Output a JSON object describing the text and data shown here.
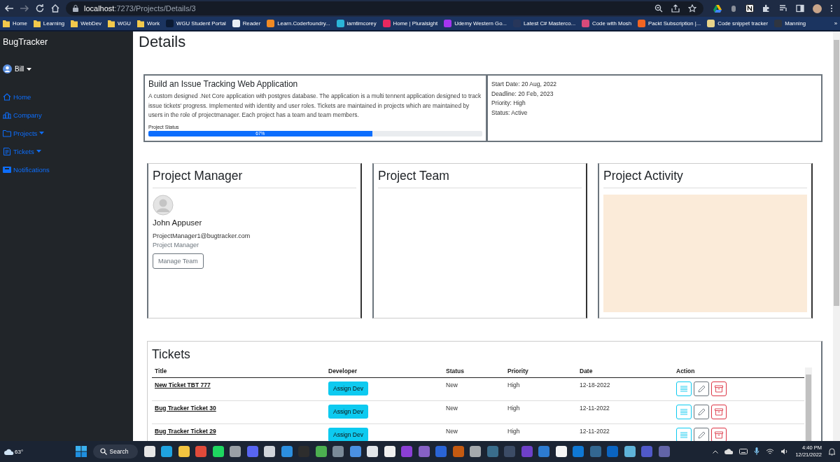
{
  "browser": {
    "url_host": "localhost",
    "url_path": ":7273/Projects/Details/3",
    "bookmarks": [
      {
        "label": "Home",
        "kind": "folder",
        "color": "#f2c94c"
      },
      {
        "label": "Learning",
        "kind": "folder",
        "color": "#f2c94c"
      },
      {
        "label": "WebDev",
        "kind": "folder",
        "color": "#f2c94c"
      },
      {
        "label": "WGU",
        "kind": "folder",
        "color": "#f2c94c"
      },
      {
        "label": "Work",
        "kind": "folder",
        "color": "#f2c94c"
      },
      {
        "label": "WGU Student Portal",
        "kind": "site",
        "color": "#0b1a33"
      },
      {
        "label": "Reader",
        "kind": "site",
        "color": "#e8eef5"
      },
      {
        "label": "Learn.Coderfoundry...",
        "kind": "site",
        "color": "#f08a24"
      },
      {
        "label": "iamtimcorey",
        "kind": "site",
        "color": "#2bb5d8"
      },
      {
        "label": "Home | Pluralsight",
        "kind": "site",
        "color": "#e8285f"
      },
      {
        "label": "Udemy Western Go...",
        "kind": "site",
        "color": "#a435f0"
      },
      {
        "label": "Latest C# Masterco...",
        "kind": "site",
        "color": "#27365a"
      },
      {
        "label": "Code with Mosh",
        "kind": "site",
        "color": "#d84a7a"
      },
      {
        "label": "Packt Subscription |...",
        "kind": "site",
        "color": "#f26522"
      },
      {
        "label": "Code snippet tracker",
        "kind": "site",
        "color": "#e8d48a"
      },
      {
        "label": "Manning",
        "kind": "site",
        "color": "#2f3540"
      }
    ],
    "more": "»"
  },
  "sidebar": {
    "brand": "BugTracker",
    "user": "Bill",
    "items": [
      {
        "label": "Home",
        "expandable": false
      },
      {
        "label": "Company",
        "expandable": false
      },
      {
        "label": "Projects",
        "expandable": true
      },
      {
        "label": "Tickets",
        "expandable": true
      },
      {
        "label": "Notifications",
        "expandable": false
      }
    ]
  },
  "page": {
    "heading": "Details"
  },
  "project": {
    "title": "Build an Issue Tracking Web Application",
    "description": "A custom designed .Net Core application with postgres database. The application is a multi tennent application designed to track issue tickets' progress. Implemented with identity and user roles. Tickets are maintained in projects which are maintained by users in the role of projectmanager. Each project has a team and team members.",
    "progress_label": "Project Status",
    "progress": {
      "level": 0.67,
      "text": "67%"
    },
    "info": [
      "Start Date: 20 Aug, 2022",
      "Deadline: 20 Feb, 2023",
      "Priority: High",
      "Status: Active"
    ]
  },
  "manager_card": {
    "title": "Project Manager",
    "name": "John Appuser",
    "email": "ProjectManager1@bugtracker.com",
    "role": "Project Manager",
    "button": "Manage Team"
  },
  "team_card": {
    "title": "Project Team"
  },
  "activity_card": {
    "title": "Project Activity"
  },
  "tickets": {
    "title": "Tickets",
    "columns": [
      "Title",
      "Developer",
      "Status",
      "Priority",
      "Date",
      "Action"
    ],
    "rows": [
      {
        "title": "New Ticket TBT 777",
        "developer_button": "Assign Dev",
        "status": "New",
        "priority": "High",
        "date": "12-18-2022"
      },
      {
        "title": "Bug Tracker Ticket 30",
        "developer_button": "Assign Dev",
        "status": "New",
        "priority": "High",
        "date": "12-11-2022"
      },
      {
        "title": "Bug Tracker Ticket 29",
        "developer_button": "Assign Dev",
        "status": "New",
        "priority": "High",
        "date": "12-11-2022"
      }
    ]
  },
  "taskbar": {
    "weather": "63°",
    "search": "Search",
    "apps": [
      {
        "color": "#e6e6e6"
      },
      {
        "color": "#1fa3e0"
      },
      {
        "color": "#f3c440"
      },
      {
        "color": "#e04a3a"
      },
      {
        "color": "#1ed760"
      },
      {
        "color": "#9aa0a6"
      },
      {
        "color": "#5865f2"
      },
      {
        "color": "#d0d4da"
      },
      {
        "color": "#2c8fe0"
      },
      {
        "color": "#2d2d2d"
      },
      {
        "color": "#4caf50"
      },
      {
        "color": "#7a8a99"
      },
      {
        "color": "#4a90e2"
      },
      {
        "color": "#e2e6ea"
      },
      {
        "color": "#f0f0f0"
      },
      {
        "color": "#8b3fd6"
      },
      {
        "color": "#8661c5"
      },
      {
        "color": "#2a64d6"
      },
      {
        "color": "#c55a11"
      },
      {
        "color": "#a5a9ad"
      },
      {
        "color": "#3a6d8c"
      },
      {
        "color": "#3c4c66"
      },
      {
        "color": "#6e40c9"
      },
      {
        "color": "#2d7bd1"
      },
      {
        "color": "#f5f5f5"
      },
      {
        "color": "#0f78d4"
      },
      {
        "color": "#336791"
      },
      {
        "color": "#0a64c2"
      },
      {
        "color": "#5fb3d9"
      },
      {
        "color": "#5059c9"
      },
      {
        "color": "#6264a7"
      }
    ],
    "time": "4:40 PM",
    "date": "12/21/2022"
  }
}
